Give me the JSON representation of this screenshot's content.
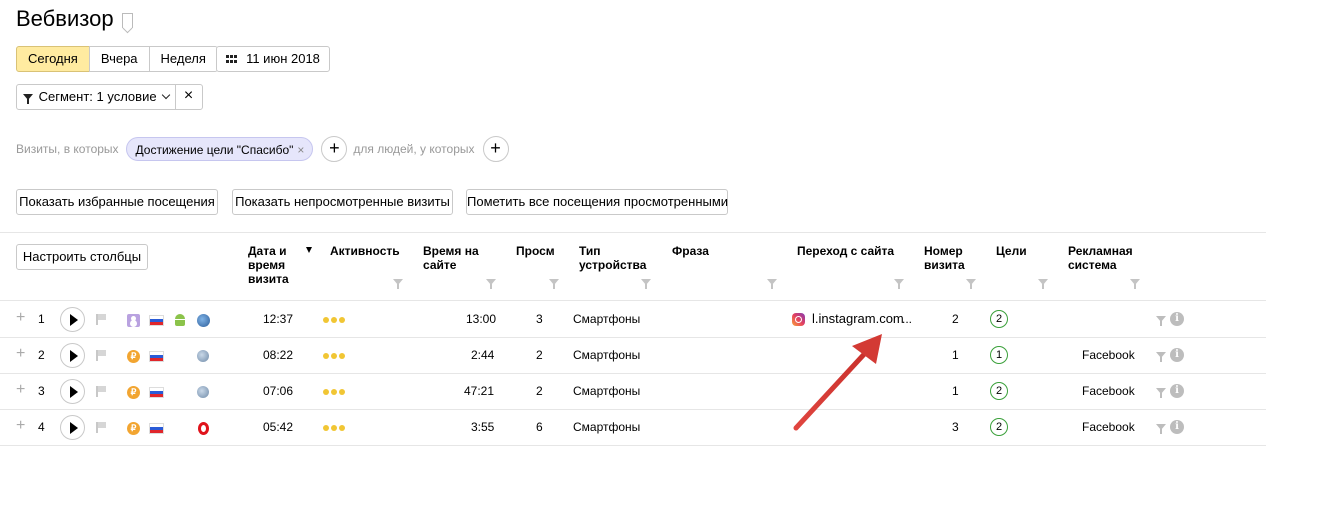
{
  "page": {
    "title": "Вебвизор"
  },
  "period": {
    "buttons": [
      "Сегодня",
      "Вчера",
      "Неделя"
    ],
    "selected": "Сегодня",
    "date_label": "11 июн 2018"
  },
  "segment": {
    "label": "Сегмент: 1 условие",
    "clear": "×"
  },
  "conditions": {
    "visits_prefix": "Визиты, в которых",
    "chip_label": "Достижение цели \"Спасибо\"",
    "chip_remove": "×",
    "people_prefix": "для людей, у которых",
    "add": "+"
  },
  "actions": {
    "show_favorites": "Показать избранные посещения",
    "show_unviewed": "Показать непросмотренные визиты",
    "mark_all_viewed": "Пометить все посещения просмотренными"
  },
  "table": {
    "configure_columns": "Настроить столбцы",
    "headers": {
      "datetime": "Дата и время визита",
      "activity": "Активность",
      "time_on_site": "Время на сайте",
      "views": "Просм",
      "device_type": "Тип устройства",
      "phrase": "Фраза",
      "referrer": "Переход с сайта",
      "visit_number": "Номер визита",
      "goals": "Цели",
      "ad_system": "Рекламная система"
    },
    "rows": [
      {
        "n": "1",
        "time": "12:37",
        "duration": "13:00",
        "views": "3",
        "device": "Смартфоны",
        "referrer": "l.instagram.com",
        "referrer_more": "...",
        "visit_number": "2",
        "goals": "2",
        "ad_system": "",
        "user_icon": "user-icon",
        "browser_icon": "globe-icon",
        "os_icon": "android-icon"
      },
      {
        "n": "2",
        "time": "08:22",
        "duration": "2:44",
        "views": "2",
        "device": "Смартфоны",
        "referrer": "",
        "referrer_more": "",
        "visit_number": "1",
        "goals": "1",
        "ad_system": "Facebook",
        "user_icon": "coin-icon",
        "browser_icon": "safari-icon"
      },
      {
        "n": "3",
        "time": "07:06",
        "duration": "47:21",
        "views": "2",
        "device": "Смартфоны",
        "referrer": "",
        "referrer_more": "",
        "visit_number": "1",
        "goals": "2",
        "ad_system": "Facebook",
        "user_icon": "coin-icon",
        "browser_icon": "safari-icon"
      },
      {
        "n": "4",
        "time": "05:42",
        "duration": "3:55",
        "views": "6",
        "device": "Смартфоны",
        "referrer": "",
        "referrer_more": "",
        "visit_number": "3",
        "goals": "2",
        "ad_system": "Facebook",
        "user_icon": "coin-icon",
        "browser_icon": "opera-icon"
      }
    ],
    "expand_symbol": "+",
    "coin_symbol": "₽",
    "info_symbol": "i"
  },
  "colors": {
    "selected_period": "#ffeba0",
    "chip_bg": "#e6e6fb",
    "activity_dots": "#f1c634",
    "goal_circle": "#3aa03a",
    "annotation_arrow": "#d93a35"
  }
}
